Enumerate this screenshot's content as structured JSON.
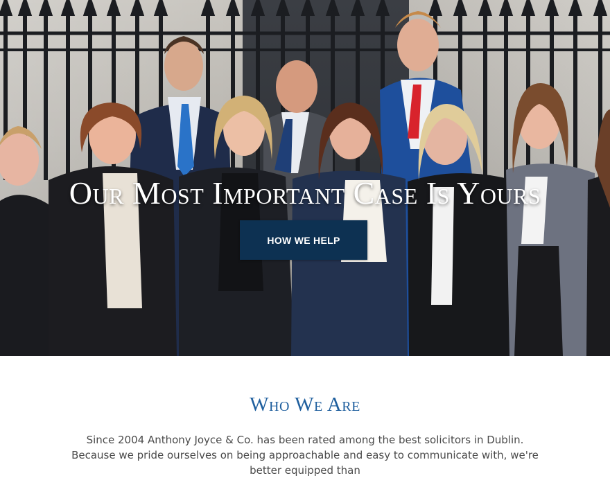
{
  "hero": {
    "title": "Our Most Important Case Is Yours",
    "button_label": "HOW WE HELP"
  },
  "about": {
    "title": "Who We Are",
    "text": "Since 2004 Anthony Joyce & Co. has been rated among the best solicitors in Dublin. Because we pride ourselves on being approachable and easy to communicate with, we're better equipped than"
  },
  "colors": {
    "button_bg": "#0d3152",
    "heading_blue": "#1f5f9e",
    "body_text": "#4a4a4a"
  }
}
